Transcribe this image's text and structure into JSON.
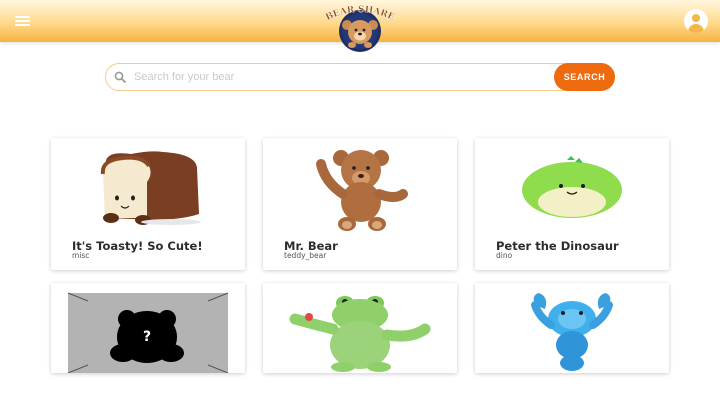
{
  "header": {
    "logo_text": "BEAR SHARE"
  },
  "search": {
    "placeholder": "Search for your bear",
    "button_label": "SEARCH"
  },
  "cards": [
    {
      "title": "It's Toasty! So Cute!",
      "category": "misc"
    },
    {
      "title": "Mr. Bear",
      "category": "teddy_bear"
    },
    {
      "title": "Peter the Dinosaur",
      "category": "dino"
    },
    {
      "title": "",
      "category": ""
    },
    {
      "title": "",
      "category": ""
    },
    {
      "title": "",
      "category": ""
    }
  ],
  "colors": {
    "accent": "#ee6a0e",
    "header_gradient_top": "#fff7de",
    "header_gradient_bottom": "#f7b341",
    "search_border": "#f4c98e"
  },
  "icons": {
    "menu": "menu-icon",
    "profile": "profile-icon",
    "search": "search-icon",
    "placeholder_image": "question-mark-icon"
  }
}
